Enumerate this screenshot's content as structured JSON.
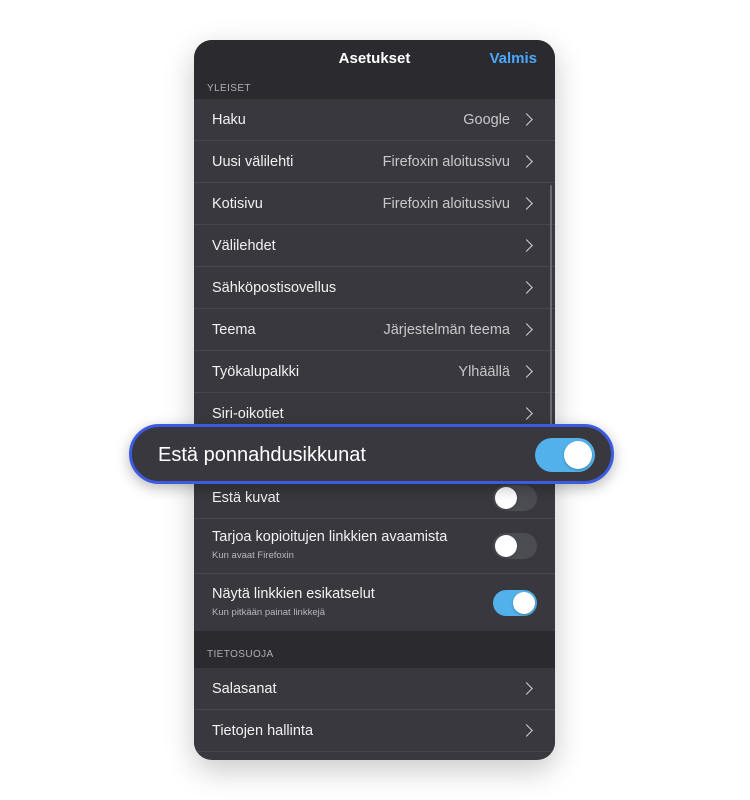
{
  "navbar": {
    "title": "Asetukset",
    "done_label": "Valmis"
  },
  "sections": {
    "general_header": "YLEISET",
    "privacy_header": "TIETOSUOJA"
  },
  "general_rows": [
    {
      "label": "Haku",
      "value": "Google"
    },
    {
      "label": "Uusi välilehti",
      "value": "Firefoxin aloitussivu"
    },
    {
      "label": "Kotisivu",
      "value": "Firefoxin aloitussivu"
    },
    {
      "label": "Välilehdet",
      "value": ""
    },
    {
      "label": "Sähköpostisovellus",
      "value": ""
    },
    {
      "label": "Teema",
      "value": "Järjestelmän teema"
    },
    {
      "label": "Työkalupalkki",
      "value": "Ylhäällä"
    },
    {
      "label": "Siri-oikotiet",
      "value": ""
    }
  ],
  "toggle_rows": [
    {
      "label": "Estä kuvat",
      "subtitle": "",
      "on": false
    },
    {
      "label": "Tarjoa kopioitujen linkkien avaamista",
      "subtitle": "Kun avaat Firefoxin",
      "on": false
    },
    {
      "label": "Näytä linkkien esikatselut",
      "subtitle": "Kun pitkään painat linkkejä",
      "on": true
    }
  ],
  "privacy_rows": [
    {
      "label": "Salasanat"
    },
    {
      "label": "Tietojen hallinta"
    }
  ],
  "callout": {
    "label": "Estä ponnahdusikkunat",
    "on": true
  },
  "colors": {
    "accent": "#52b1ea",
    "done": "#4aa8ff",
    "highlight_border": "#3c5be0",
    "background": "#38383e"
  }
}
